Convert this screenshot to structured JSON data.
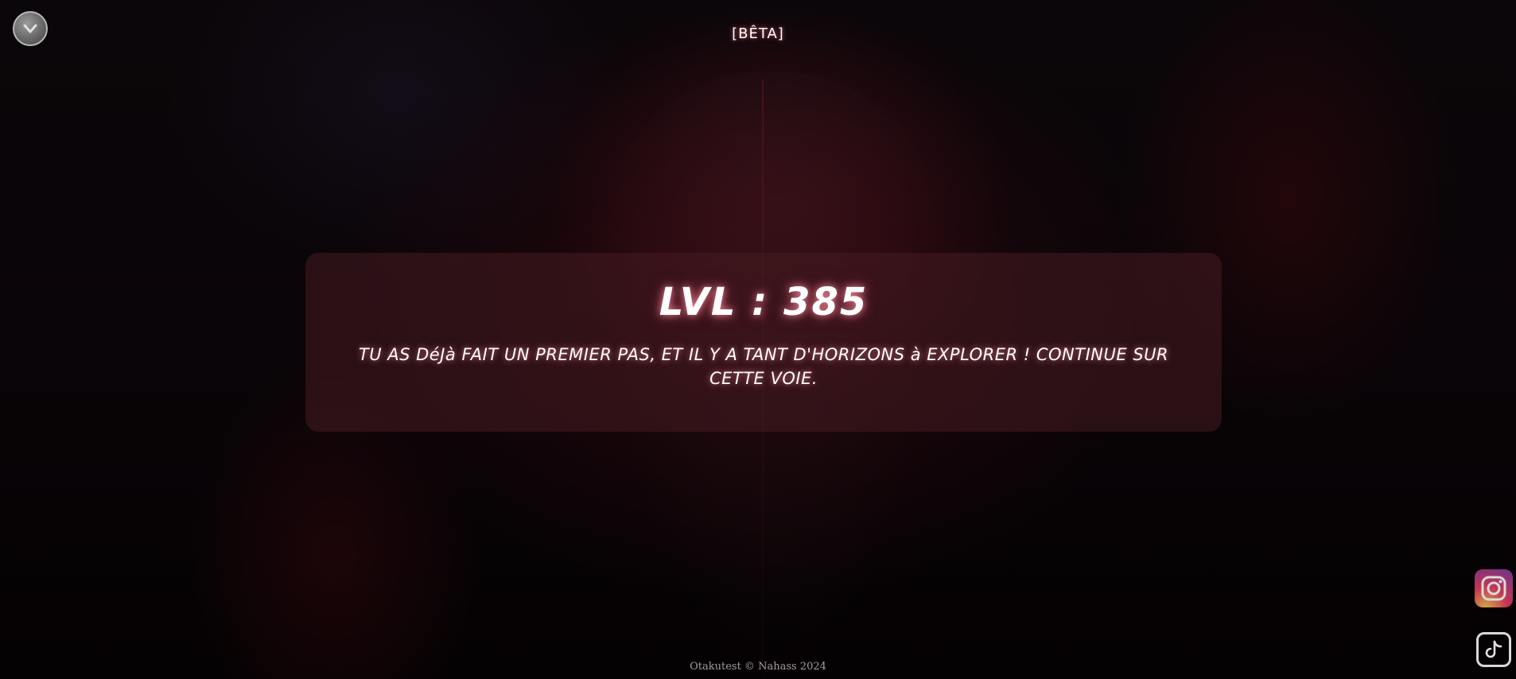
{
  "header": {
    "badge": "[BÊTA]"
  },
  "result": {
    "level": "LVL : 385",
    "message": "TU AS DéJà FAIT UN PREMIER PAS, ET IL Y A TANT D'HORIZONS à EXPLORER ! CONTINUE SUR CETTE VOIE."
  },
  "footer": {
    "text": "Otakutest © Nahass 2024"
  },
  "icons": {
    "menu": "chevron-down-icon",
    "instagram": "instagram-icon",
    "tiktok": "tiktok-icon"
  },
  "colors": {
    "accent_glow": "#ff96aa",
    "card_background": "#461c20",
    "page_background": "#050304"
  }
}
